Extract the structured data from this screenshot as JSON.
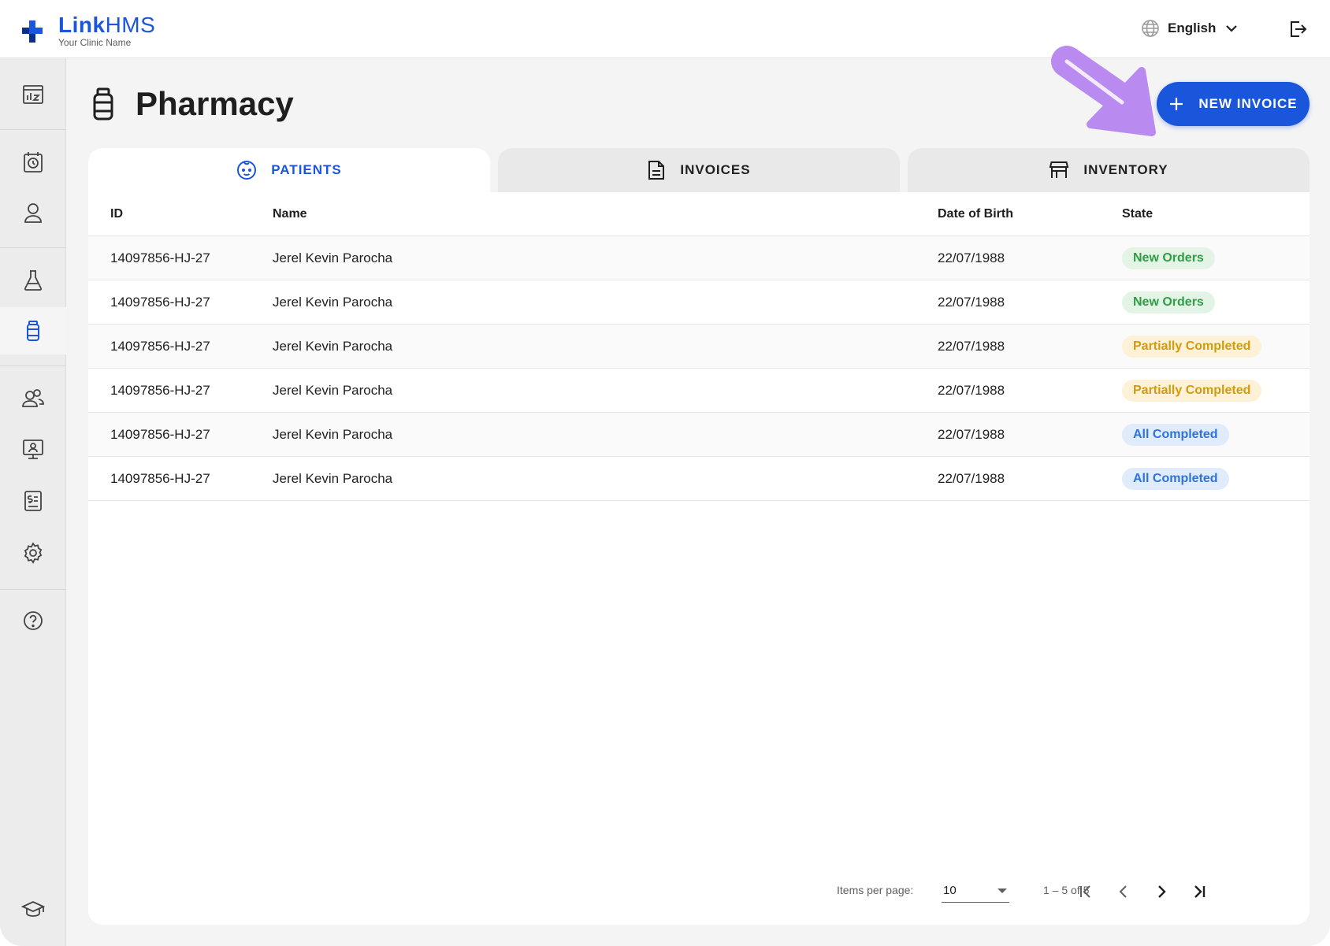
{
  "header": {
    "brand_link": "Link",
    "brand_hms": "HMS",
    "brand_sub": "Your Clinic Name",
    "language": "English",
    "icons": {
      "language": "globe-icon",
      "language_toggle": "chevron-down-icon",
      "logout": "logout-icon"
    }
  },
  "sidebar": {
    "items": [
      {
        "name": "dashboard",
        "icon": "chart-board-icon",
        "active": false
      },
      {
        "name": "appointments",
        "icon": "calendar-clock-icon",
        "active": false
      },
      {
        "name": "patients",
        "icon": "person-icon",
        "active": false
      },
      {
        "name": "laboratory",
        "icon": "flask-icon",
        "active": false
      },
      {
        "name": "pharmacy",
        "icon": "pill-bottle-icon",
        "active": true
      },
      {
        "name": "staff",
        "icon": "people-icon",
        "active": false
      },
      {
        "name": "display",
        "icon": "monitor-person-icon",
        "active": false
      },
      {
        "name": "billing",
        "icon": "dollar-document-icon",
        "active": false
      },
      {
        "name": "settings",
        "icon": "gear-icon",
        "active": false
      },
      {
        "name": "help",
        "icon": "question-circle-icon",
        "active": false
      },
      {
        "name": "training",
        "icon": "graduation-cap-icon",
        "active": false
      }
    ]
  },
  "page": {
    "title": "Pharmacy",
    "new_invoice_label": "NEW INVOICE",
    "accent_color": "#1a56db"
  },
  "tabs": [
    {
      "label": "PATIENTS",
      "icon": "baby-face-icon",
      "active": true
    },
    {
      "label": "INVOICES",
      "icon": "document-icon",
      "active": false
    },
    {
      "label": "INVENTORY",
      "icon": "store-icon",
      "active": false
    }
  ],
  "table": {
    "columns": [
      "ID",
      "Name",
      "Date of Birth",
      "State"
    ],
    "rows": [
      {
        "id": "14097856-HJ-27",
        "name": "Jerel Kevin Parocha",
        "dob": "22/07/1988",
        "state": "New Orders",
        "state_kind": "new"
      },
      {
        "id": "14097856-HJ-27",
        "name": "Jerel Kevin Parocha",
        "dob": "22/07/1988",
        "state": "New Orders",
        "state_kind": "new"
      },
      {
        "id": "14097856-HJ-27",
        "name": "Jerel Kevin Parocha",
        "dob": "22/07/1988",
        "state": "Partially Completed",
        "state_kind": "part"
      },
      {
        "id": "14097856-HJ-27",
        "name": "Jerel Kevin Parocha",
        "dob": "22/07/1988",
        "state": "Partially Completed",
        "state_kind": "part"
      },
      {
        "id": "14097856-HJ-27",
        "name": "Jerel Kevin Parocha",
        "dob": "22/07/1988",
        "state": "All Completed",
        "state_kind": "all"
      },
      {
        "id": "14097856-HJ-27",
        "name": "Jerel Kevin Parocha",
        "dob": "22/07/1988",
        "state": "All Completed",
        "state_kind": "all"
      }
    ]
  },
  "pagination": {
    "items_per_page_label": "Items per page:",
    "items_per_page": "10",
    "range": "1 – 5 of 5",
    "icons": [
      "first-page-icon",
      "previous-page-icon",
      "next-page-icon",
      "last-page-icon"
    ]
  }
}
